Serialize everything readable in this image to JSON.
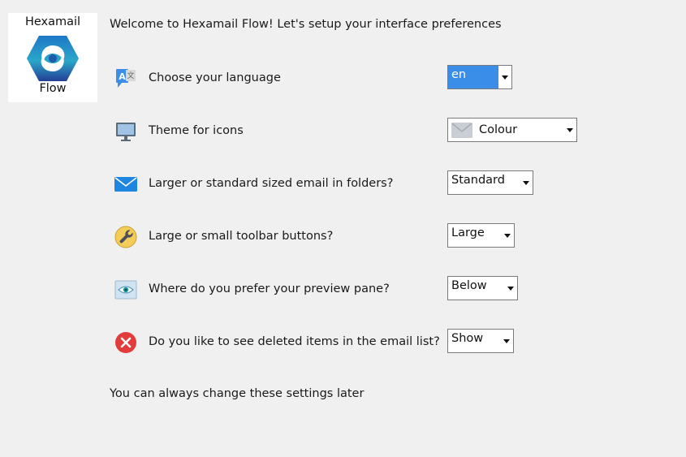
{
  "logo": {
    "top_text": "Hexamail",
    "bottom_text": "Flow"
  },
  "welcome_text": "Welcome to Hexamail Flow! Let's setup your interface preferences",
  "footer_text": "You can always change these settings later",
  "colors": {
    "background": "#f0f0f0",
    "accent": "#3b8ee8",
    "hex_blue": "#2a4fa3",
    "hex_teal": "#2aa6c9",
    "error_red": "#e23b3b"
  },
  "settings": [
    {
      "icon": "language-icon",
      "label": "Choose your language",
      "value": "en"
    },
    {
      "icon": "monitor-icon",
      "label": "Theme for icons",
      "value": "Colour"
    },
    {
      "icon": "envelope-icon",
      "label": "Larger or standard sized email in folders?",
      "value": "Standard"
    },
    {
      "icon": "wrench-icon",
      "label": "Large or small toolbar buttons?",
      "value": "Large"
    },
    {
      "icon": "eye-icon",
      "label": "Where do you prefer your preview pane?",
      "value": "Below"
    },
    {
      "icon": "delete-icon",
      "label": "Do you like to see deleted items in the email list?",
      "value": "Show"
    }
  ]
}
